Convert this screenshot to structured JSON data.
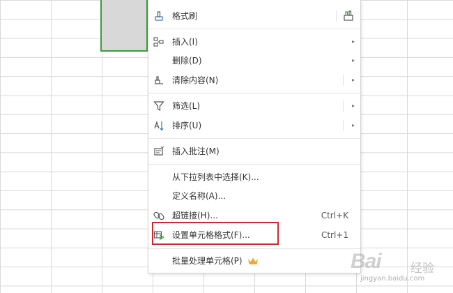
{
  "menu": {
    "format_painter": {
      "label": "格式刷"
    },
    "insert": {
      "label": "插入(I)"
    },
    "delete": {
      "label": "删除(D)"
    },
    "clear": {
      "label": "清除内容(N)"
    },
    "filter": {
      "label": "筛选(L)"
    },
    "sort": {
      "label": "排序(U)"
    },
    "insert_comment": {
      "label": "插入批注(M)"
    },
    "pick_from_list": {
      "label": "从下拉列表中选择(K)..."
    },
    "define_name": {
      "label": "定义名称(A)..."
    },
    "hyperlink": {
      "label": "超链接(H)...",
      "shortcut": "Ctrl+K"
    },
    "format_cells": {
      "label": "设置单元格格式(F)...",
      "shortcut": "Ctrl+1"
    },
    "batch_process": {
      "label": "批量处理单元格(P)"
    },
    "submenu_arrow": "▸"
  },
  "watermark": {
    "brand": "Bai",
    "brand2": "经验",
    "url": "jingyan.baidu.com"
  },
  "colors": {
    "selection_border": "#3c9c3a",
    "highlight_box": "#cc2a2f",
    "crown": "#f0a830",
    "icon_blue": "#3a6fc8"
  }
}
